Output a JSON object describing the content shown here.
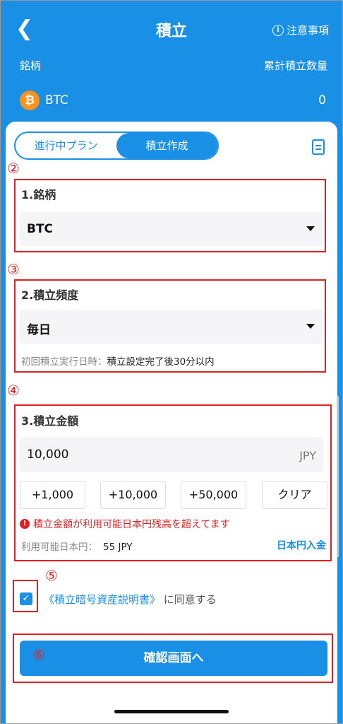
{
  "header": {
    "back_icon": "chevron-left-icon",
    "title": "積立",
    "notice_label": "注意事項",
    "info_glyph": "i",
    "col_left": "銘柄",
    "col_right": "累計積立数量"
  },
  "holding": {
    "symbol": "BTC",
    "icon_glyph": "₿",
    "quantity": "0"
  },
  "tabs": {
    "in_progress": "進行中プラン",
    "create": "積立作成"
  },
  "markers": {
    "m2": "②",
    "m3": "③",
    "m4": "④",
    "m5": "⑤",
    "m6": "⑥"
  },
  "section1": {
    "title": "1.銘柄",
    "value": "BTC"
  },
  "section2": {
    "title": "2.積立頻度",
    "value": "毎日",
    "hint_label": "初回積立実行日時：",
    "hint_value": "積立設定完了後30分以内"
  },
  "section3": {
    "title": "3.積立金額",
    "amount": "10,000",
    "unit": "JPY",
    "quick": [
      "+1,000",
      "+10,000",
      "+50,000",
      "クリア"
    ],
    "error_glyph": "!",
    "error": "積立金額が利用可能日本円残高を超えてます",
    "avail_label": "利用可能日本円：",
    "avail_value": "55 JPY",
    "deposit": "日本円入金"
  },
  "agree": {
    "link": "《積立暗号資産説明書》",
    "text": " に同意する",
    "check_glyph": "✓"
  },
  "confirm": "確認画面へ",
  "colors": {
    "primary": "#1a8fe6",
    "annotation": "#e02020",
    "btc": "#f7931a"
  }
}
